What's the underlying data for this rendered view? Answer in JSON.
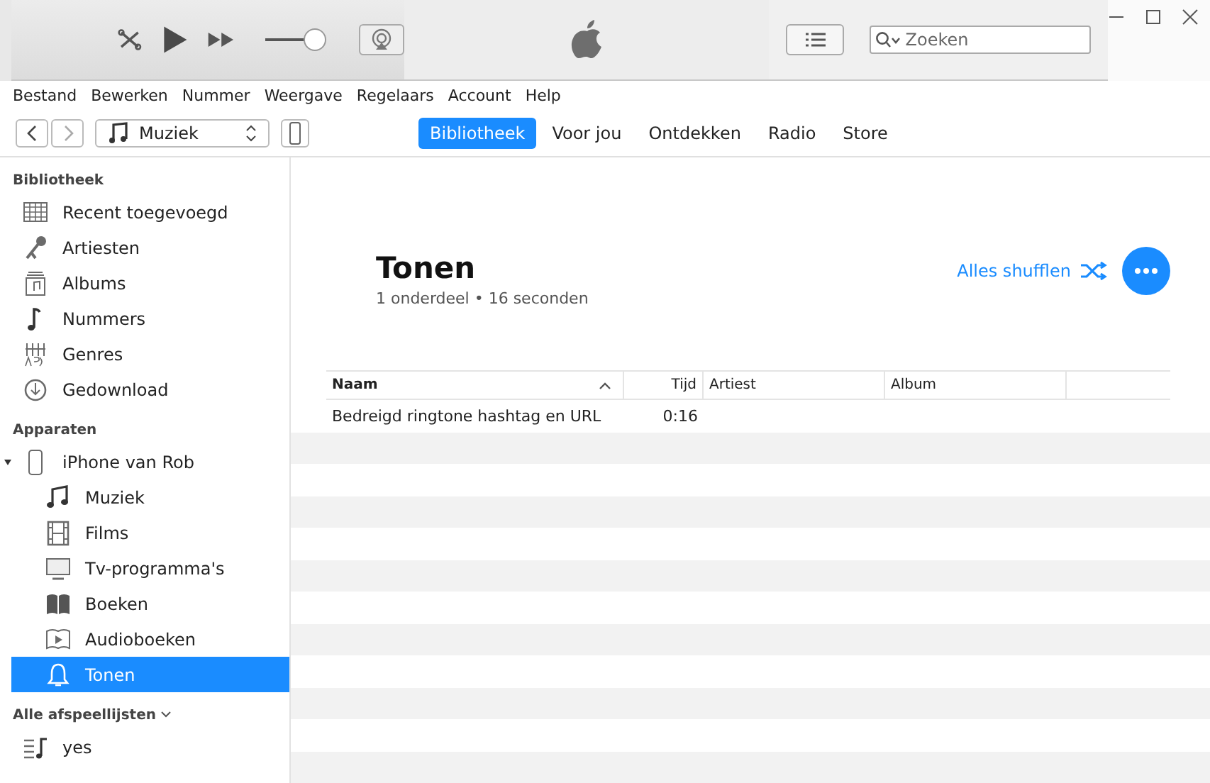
{
  "toolbar": {
    "volume": {
      "level": 0.82
    },
    "search": {
      "placeholder": "Zoeken"
    }
  },
  "menu": [
    "Bestand",
    "Bewerken",
    "Nummer",
    "Weergave",
    "Regelaars",
    "Account",
    "Help"
  ],
  "nav": {
    "source": "Muziek",
    "tabs": [
      {
        "label": "Bibliotheek",
        "selected": true
      },
      {
        "label": "Voor jou",
        "selected": false
      },
      {
        "label": "Ontdekken",
        "selected": false
      },
      {
        "label": "Radio",
        "selected": false
      },
      {
        "label": "Store",
        "selected": false
      }
    ]
  },
  "sidebar": {
    "sections": [
      {
        "title": "Bibliotheek",
        "has_menu": false,
        "items": [
          {
            "label": "Recent toegevoegd",
            "kind": "grid",
            "selected": false
          },
          {
            "label": "Artiesten",
            "kind": "mic",
            "selected": false
          },
          {
            "label": "Albums",
            "kind": "album",
            "selected": false
          },
          {
            "label": "Nummers",
            "kind": "note",
            "selected": false
          },
          {
            "label": "Genres",
            "kind": "genres",
            "selected": false
          },
          {
            "label": "Gedownload",
            "kind": "download",
            "selected": false
          }
        ]
      },
      {
        "title": "Apparaten",
        "has_menu": false,
        "items": [
          {
            "label": "iPhone van Rob",
            "kind": "phone",
            "selected": false,
            "expanded": true,
            "children": [
              {
                "label": "Muziek",
                "kind": "music",
                "selected": false
              },
              {
                "label": "Films",
                "kind": "film",
                "selected": false
              },
              {
                "label": "Tv-programma's",
                "kind": "tv",
                "selected": false
              },
              {
                "label": "Boeken",
                "kind": "book",
                "selected": false
              },
              {
                "label": "Audioboeken",
                "kind": "audiobook",
                "selected": false
              },
              {
                "label": "Tonen",
                "kind": "bell",
                "selected": true
              }
            ]
          }
        ]
      },
      {
        "title": "Alle afspeellijsten",
        "has_menu": true,
        "items": [
          {
            "label": "yes",
            "kind": "playlist",
            "selected": false
          }
        ]
      }
    ]
  },
  "content": {
    "title": "Tonen",
    "subtitle": "1 onderdeel • 16 seconden",
    "shuffle": "Alles shufflen",
    "table": {
      "columns": [
        {
          "label": "Naam",
          "sorted": true,
          "bold": true
        },
        {
          "label": "Tijd",
          "sorted": false,
          "bold": false
        },
        {
          "label": "Artiest",
          "sorted": false,
          "bold": false
        },
        {
          "label": "Album",
          "sorted": false,
          "bold": false
        }
      ],
      "rows": [
        {
          "cells": [
            "Bedreigd ringtone hashtag en URL",
            "0:16"
          ]
        }
      ]
    }
  }
}
